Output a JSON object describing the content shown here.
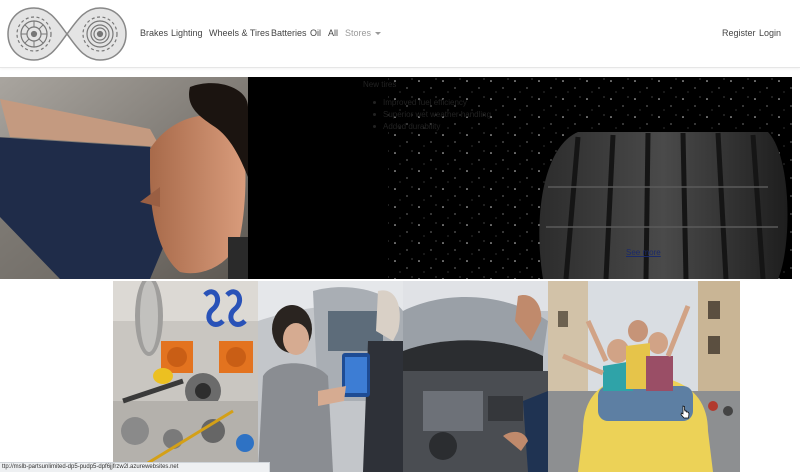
{
  "nav": {
    "items": [
      "Brakes",
      "Lighting",
      "Wheels & Tires",
      "Batteries",
      "Oil",
      "All"
    ],
    "stores_label": "Stores",
    "register_label": "Register",
    "login_label": "Login"
  },
  "hero": {
    "title": "New tires",
    "bullets": [
      "Improved fuel efficiency",
      "Superior wet weather handling",
      "Added durability"
    ],
    "link_text": "See more"
  },
  "status": {
    "url": "ttp://mslb-partsunlimited-dp5-pudp5-dpf6jjfrzw2l.azurewebsites.net"
  },
  "colors": {
    "nav_text": "#444444",
    "nav_muted": "#9a9a9a",
    "hero_background": "#000000"
  }
}
